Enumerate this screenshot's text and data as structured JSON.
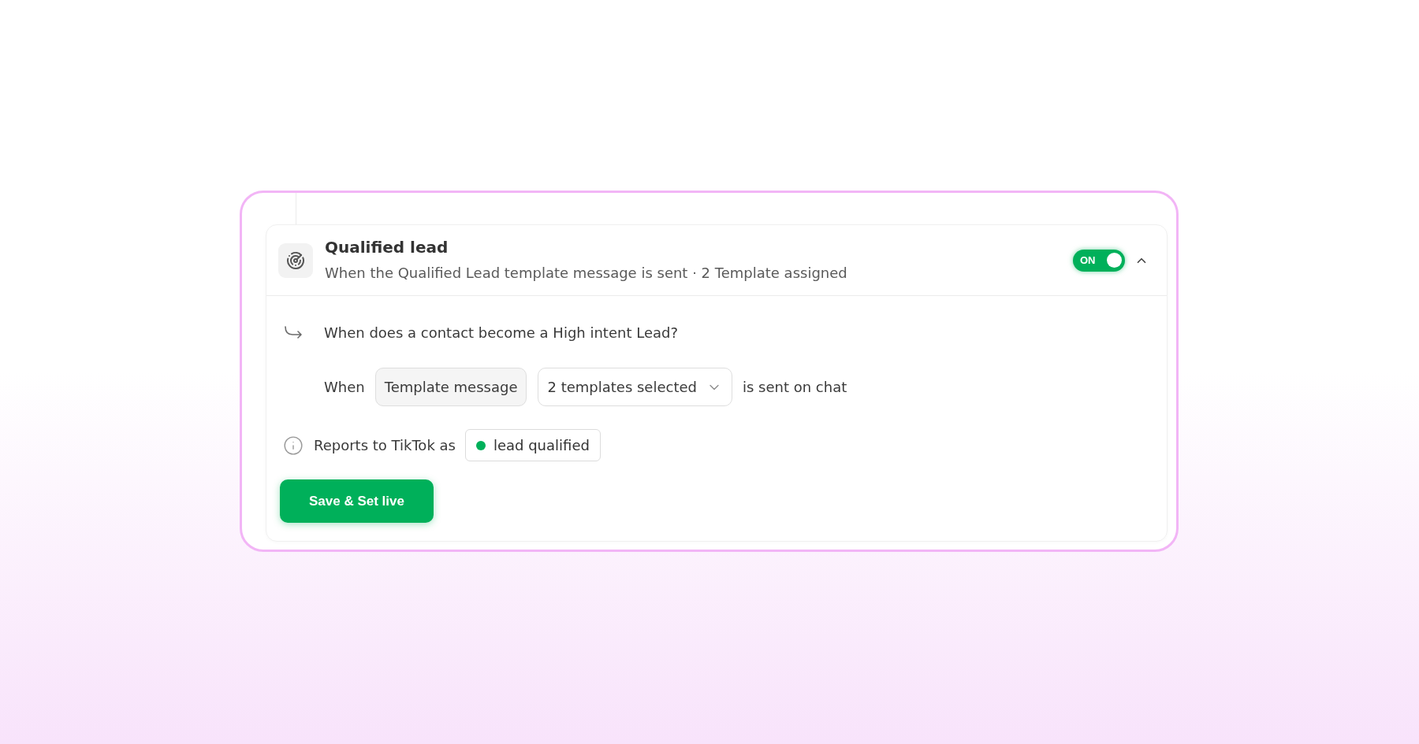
{
  "card": {
    "title": "Qualified lead",
    "subtitle": "When the Qualified Lead template message is sent · 2 Template assigned",
    "toggle": {
      "label": "ON",
      "on": true
    },
    "expanded": true,
    "question": "When does a contact become a High intent Lead?",
    "condition": {
      "prefix": "When",
      "trigger": "Template message",
      "selector": "2 templates selected",
      "suffix": "is sent on chat"
    },
    "report": {
      "label": "Reports to TikTok as",
      "event": "lead qualified"
    },
    "button": "Save & Set live"
  }
}
